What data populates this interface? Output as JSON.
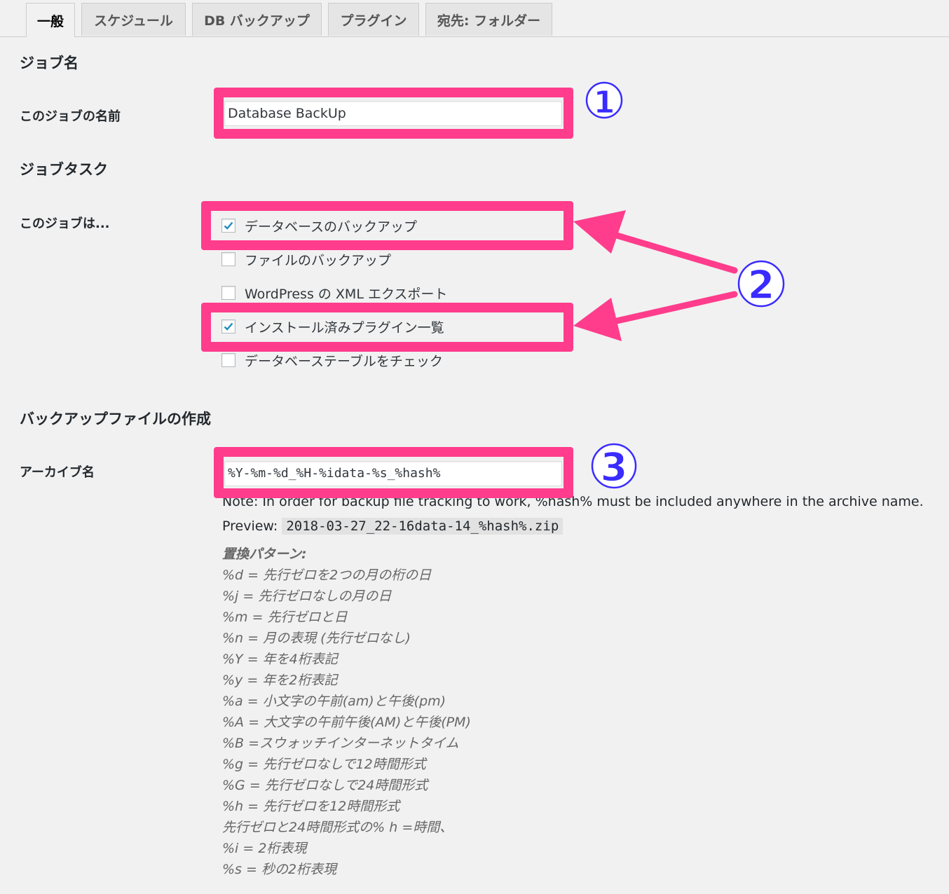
{
  "tabs": [
    {
      "label": "一般",
      "active": true
    },
    {
      "label": "スケジュール",
      "active": false
    },
    {
      "label": "DB バックアップ",
      "active": false
    },
    {
      "label": "プラグイン",
      "active": false
    },
    {
      "label": "宛先: フォルダー",
      "active": false
    }
  ],
  "job_name": {
    "heading": "ジョブ名",
    "label": "このジョブの名前",
    "value": "Database BackUp"
  },
  "job_tasks": {
    "heading": "ジョブタスク",
    "label": "このジョブは...",
    "options": [
      {
        "label": "データベースのバックアップ",
        "checked": true
      },
      {
        "label": "ファイルのバックアップ",
        "checked": false
      },
      {
        "label": "WordPress の XML エクスポート",
        "checked": false
      },
      {
        "label": "インストール済みプラグイン一覧",
        "checked": true
      },
      {
        "label": "データベーステーブルをチェック",
        "checked": false
      }
    ]
  },
  "backup_file": {
    "heading": "バックアップファイルの作成",
    "archive_label": "アーカイブ名",
    "archive_value": "%Y-%m-%d_%H-%idata-%s_%hash%",
    "note": "Note: In order for backup file tracking to work, %hash% must be included anywhere in the archive name.",
    "preview_label": "Preview:",
    "preview_value": "2018-03-27_22-16data-14_%hash%.zip",
    "patterns_title": "置換パターン:",
    "patterns": [
      "%d = 先行ゼロを2つの月の桁の日",
      "%j = 先行ゼロなしの月の日",
      "%m = 先行ゼロと日",
      "%n = 月の表現 (先行ゼロなし)",
      "%Y = 年を4桁表記",
      "%y = 年を2桁表記",
      "%a = 小文字の午前(am)と午後(pm)",
      "%A = 大文字の午前午後(AM)と午後(PM)",
      "%B =スウォッチインターネットタイム",
      "%g = 先行ゼロなしで12時間形式",
      "%G = 先行ゼロなしで24時間形式",
      "%h = 先行ゼロを12時間形式",
      "先行ゼロと24時間形式の% h =時間、",
      "%i = 2桁表現",
      "%s = 秒の2桁表現"
    ]
  },
  "annotations": {
    "number_1": "①",
    "number_2": "2",
    "number_3": "3",
    "highlight_color": "#ff3d8c",
    "number_color": "#3a2bff"
  },
  "colors": {
    "background": "#f1f1f1",
    "checkmark": "#1e8cbe"
  }
}
